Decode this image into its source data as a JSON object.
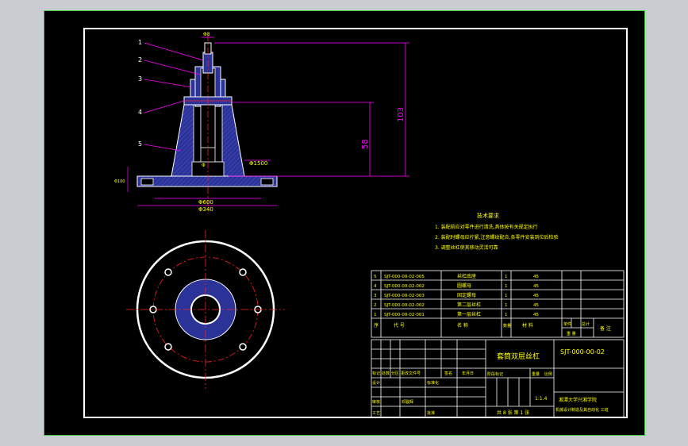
{
  "colors": {
    "background": "#000000",
    "frame": "#ffffff",
    "outer_border": "#3ec63e",
    "dimension": "#ff00ff",
    "text": "#ffff00",
    "part_fill": "#2b3399",
    "centerline": "#ff2020"
  },
  "front_view": {
    "callouts": [
      "1",
      "2",
      "3",
      "4",
      "5"
    ],
    "dimensions": {
      "top_width": "Φ8",
      "height_total": "103",
      "height_mid": "58",
      "hole_dia": "Φ1500",
      "base_height": "Φ100",
      "base_width": "Φ600",
      "base_outer": "Φ340",
      "section_label": "Φ"
    }
  },
  "notes": {
    "title": "技术要求",
    "lines": [
      "1. 装配前应对零件进行清洗,具体按有关规定执行",
      "2. 装配时螺母应拧紧,注意螺纹配合,各零件安装到位后检验",
      "3. 调整丝杠使其移动灵活可靠"
    ]
  },
  "parts_list": {
    "rows": [
      {
        "no": "5",
        "code": "SJT-000-00-02-005",
        "name": "丝杠底座",
        "qty": "1",
        "mat": "45"
      },
      {
        "no": "4",
        "code": "SJT-000-00-02-002",
        "name": "圆螺母",
        "qty": "1",
        "mat": "45"
      },
      {
        "no": "3",
        "code": "SJT-000-00-02-003",
        "name": "固定螺母",
        "qty": "1",
        "mat": "45"
      },
      {
        "no": "2",
        "code": "SJT-000-00-02-002",
        "name": "第二层丝杠",
        "qty": "1",
        "mat": "45"
      },
      {
        "no": "1",
        "code": "SJT-000-00-02-001",
        "name": "第一层丝杠",
        "qty": "1",
        "mat": "45"
      }
    ],
    "header": {
      "no": "序",
      "code": "代  号",
      "name": "名  称",
      "qty": "数量",
      "mat": "材  料",
      "single": "单件",
      "total": "总计",
      "weight": "重  量",
      "remark": "备  注"
    }
  },
  "title_block": {
    "drawing_title": "套筒双层丝杠",
    "drawing_number": "SJT-000-00-02",
    "scale": "1:1.4",
    "school": "湘潭大学兴湘学院",
    "project": "机械设计制造及其自动化 三班",
    "sheet": "共 8 张  第 1 张",
    "labels": {
      "mark": "标记",
      "count": "处数",
      "zone": "分区",
      "change_doc": "更改文件号",
      "sign": "签名",
      "date": "年月日",
      "design": "设计",
      "designer": "邓骏辉",
      "standard": "标准化",
      "check": "审核",
      "process": "工艺",
      "approve": "批准",
      "stage_mark": "阶段标记",
      "weight": "重量",
      "ratio": "比例"
    }
  }
}
